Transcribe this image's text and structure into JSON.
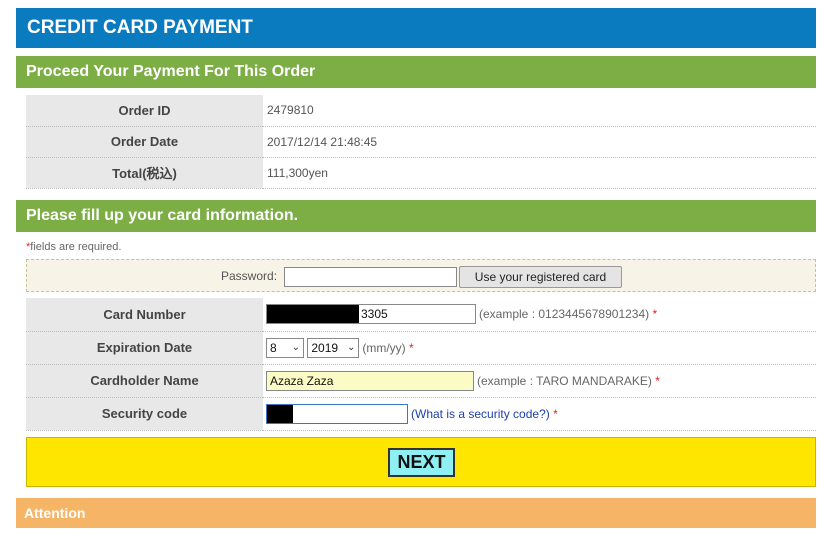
{
  "header": {
    "title": "CREDIT CARD PAYMENT"
  },
  "order_section": {
    "title": "Proceed Your Payment For This Order",
    "rows": [
      {
        "label": "Order ID",
        "value": "2479810"
      },
      {
        "label": "Order Date",
        "value": "2017/12/14 21:48:45"
      },
      {
        "label": "Total(税込)",
        "value": "111,300yen"
      }
    ]
  },
  "card_section": {
    "title": "Please fill up your card information.",
    "required_note_star": "*",
    "required_note": "fields are required.",
    "password": {
      "label": "Password:",
      "value": "",
      "button": "Use your registered card"
    },
    "card_number": {
      "label": "Card Number",
      "visible_digits": "3305",
      "hint": "(example : 0123445678901234)",
      "star": "*"
    },
    "expiration": {
      "label": "Expiration Date",
      "month": "8",
      "year": "2019",
      "hint": "(mm/yy)",
      "star": "*"
    },
    "holder": {
      "label": "Cardholder Name",
      "value": "Azaza Zaza",
      "hint": "(example : TARO MANDARAKE)",
      "star": "*"
    },
    "security": {
      "label": "Security code",
      "link": "(What is a security code?)",
      "star": "*"
    }
  },
  "next_button": {
    "label": "NEXT"
  },
  "attention": {
    "title": "Attention"
  },
  "colors": {
    "header": "#0b7bbf",
    "section": "#7dae46",
    "attention": "#f6b566",
    "next_area": "#ffe600",
    "next_button": "#8ff0f4"
  }
}
